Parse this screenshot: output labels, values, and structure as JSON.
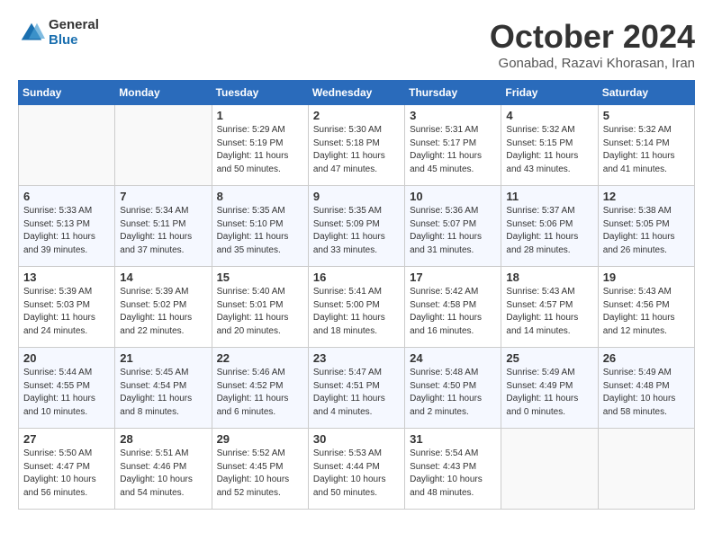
{
  "logo": {
    "general": "General",
    "blue": "Blue"
  },
  "title": "October 2024",
  "subtitle": "Gonabad, Razavi Khorasan, Iran",
  "days_of_week": [
    "Sunday",
    "Monday",
    "Tuesday",
    "Wednesday",
    "Thursday",
    "Friday",
    "Saturday"
  ],
  "weeks": [
    [
      {
        "day": "",
        "sunrise": "",
        "sunset": "",
        "daylight": ""
      },
      {
        "day": "",
        "sunrise": "",
        "sunset": "",
        "daylight": ""
      },
      {
        "day": "1",
        "sunrise": "Sunrise: 5:29 AM",
        "sunset": "Sunset: 5:19 PM",
        "daylight": "Daylight: 11 hours and 50 minutes."
      },
      {
        "day": "2",
        "sunrise": "Sunrise: 5:30 AM",
        "sunset": "Sunset: 5:18 PM",
        "daylight": "Daylight: 11 hours and 47 minutes."
      },
      {
        "day": "3",
        "sunrise": "Sunrise: 5:31 AM",
        "sunset": "Sunset: 5:17 PM",
        "daylight": "Daylight: 11 hours and 45 minutes."
      },
      {
        "day": "4",
        "sunrise": "Sunrise: 5:32 AM",
        "sunset": "Sunset: 5:15 PM",
        "daylight": "Daylight: 11 hours and 43 minutes."
      },
      {
        "day": "5",
        "sunrise": "Sunrise: 5:32 AM",
        "sunset": "Sunset: 5:14 PM",
        "daylight": "Daylight: 11 hours and 41 minutes."
      }
    ],
    [
      {
        "day": "6",
        "sunrise": "Sunrise: 5:33 AM",
        "sunset": "Sunset: 5:13 PM",
        "daylight": "Daylight: 11 hours and 39 minutes."
      },
      {
        "day": "7",
        "sunrise": "Sunrise: 5:34 AM",
        "sunset": "Sunset: 5:11 PM",
        "daylight": "Daylight: 11 hours and 37 minutes."
      },
      {
        "day": "8",
        "sunrise": "Sunrise: 5:35 AM",
        "sunset": "Sunset: 5:10 PM",
        "daylight": "Daylight: 11 hours and 35 minutes."
      },
      {
        "day": "9",
        "sunrise": "Sunrise: 5:35 AM",
        "sunset": "Sunset: 5:09 PM",
        "daylight": "Daylight: 11 hours and 33 minutes."
      },
      {
        "day": "10",
        "sunrise": "Sunrise: 5:36 AM",
        "sunset": "Sunset: 5:07 PM",
        "daylight": "Daylight: 11 hours and 31 minutes."
      },
      {
        "day": "11",
        "sunrise": "Sunrise: 5:37 AM",
        "sunset": "Sunset: 5:06 PM",
        "daylight": "Daylight: 11 hours and 28 minutes."
      },
      {
        "day": "12",
        "sunrise": "Sunrise: 5:38 AM",
        "sunset": "Sunset: 5:05 PM",
        "daylight": "Daylight: 11 hours and 26 minutes."
      }
    ],
    [
      {
        "day": "13",
        "sunrise": "Sunrise: 5:39 AM",
        "sunset": "Sunset: 5:03 PM",
        "daylight": "Daylight: 11 hours and 24 minutes."
      },
      {
        "day": "14",
        "sunrise": "Sunrise: 5:39 AM",
        "sunset": "Sunset: 5:02 PM",
        "daylight": "Daylight: 11 hours and 22 minutes."
      },
      {
        "day": "15",
        "sunrise": "Sunrise: 5:40 AM",
        "sunset": "Sunset: 5:01 PM",
        "daylight": "Daylight: 11 hours and 20 minutes."
      },
      {
        "day": "16",
        "sunrise": "Sunrise: 5:41 AM",
        "sunset": "Sunset: 5:00 PM",
        "daylight": "Daylight: 11 hours and 18 minutes."
      },
      {
        "day": "17",
        "sunrise": "Sunrise: 5:42 AM",
        "sunset": "Sunset: 4:58 PM",
        "daylight": "Daylight: 11 hours and 16 minutes."
      },
      {
        "day": "18",
        "sunrise": "Sunrise: 5:43 AM",
        "sunset": "Sunset: 4:57 PM",
        "daylight": "Daylight: 11 hours and 14 minutes."
      },
      {
        "day": "19",
        "sunrise": "Sunrise: 5:43 AM",
        "sunset": "Sunset: 4:56 PM",
        "daylight": "Daylight: 11 hours and 12 minutes."
      }
    ],
    [
      {
        "day": "20",
        "sunrise": "Sunrise: 5:44 AM",
        "sunset": "Sunset: 4:55 PM",
        "daylight": "Daylight: 11 hours and 10 minutes."
      },
      {
        "day": "21",
        "sunrise": "Sunrise: 5:45 AM",
        "sunset": "Sunset: 4:54 PM",
        "daylight": "Daylight: 11 hours and 8 minutes."
      },
      {
        "day": "22",
        "sunrise": "Sunrise: 5:46 AM",
        "sunset": "Sunset: 4:52 PM",
        "daylight": "Daylight: 11 hours and 6 minutes."
      },
      {
        "day": "23",
        "sunrise": "Sunrise: 5:47 AM",
        "sunset": "Sunset: 4:51 PM",
        "daylight": "Daylight: 11 hours and 4 minutes."
      },
      {
        "day": "24",
        "sunrise": "Sunrise: 5:48 AM",
        "sunset": "Sunset: 4:50 PM",
        "daylight": "Daylight: 11 hours and 2 minutes."
      },
      {
        "day": "25",
        "sunrise": "Sunrise: 5:49 AM",
        "sunset": "Sunset: 4:49 PM",
        "daylight": "Daylight: 11 hours and 0 minutes."
      },
      {
        "day": "26",
        "sunrise": "Sunrise: 5:49 AM",
        "sunset": "Sunset: 4:48 PM",
        "daylight": "Daylight: 10 hours and 58 minutes."
      }
    ],
    [
      {
        "day": "27",
        "sunrise": "Sunrise: 5:50 AM",
        "sunset": "Sunset: 4:47 PM",
        "daylight": "Daylight: 10 hours and 56 minutes."
      },
      {
        "day": "28",
        "sunrise": "Sunrise: 5:51 AM",
        "sunset": "Sunset: 4:46 PM",
        "daylight": "Daylight: 10 hours and 54 minutes."
      },
      {
        "day": "29",
        "sunrise": "Sunrise: 5:52 AM",
        "sunset": "Sunset: 4:45 PM",
        "daylight": "Daylight: 10 hours and 52 minutes."
      },
      {
        "day": "30",
        "sunrise": "Sunrise: 5:53 AM",
        "sunset": "Sunset: 4:44 PM",
        "daylight": "Daylight: 10 hours and 50 minutes."
      },
      {
        "day": "31",
        "sunrise": "Sunrise: 5:54 AM",
        "sunset": "Sunset: 4:43 PM",
        "daylight": "Daylight: 10 hours and 48 minutes."
      },
      {
        "day": "",
        "sunrise": "",
        "sunset": "",
        "daylight": ""
      },
      {
        "day": "",
        "sunrise": "",
        "sunset": "",
        "daylight": ""
      }
    ]
  ]
}
